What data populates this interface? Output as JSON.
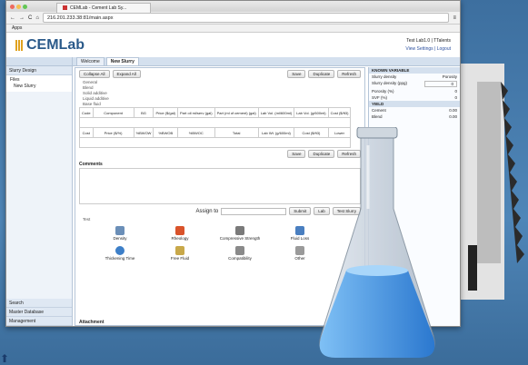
{
  "browser": {
    "tab_title": "CEMLab - Cement Lab Sy...",
    "url": "216.201.233.38:81/main.aspx",
    "bookmark": "Apps"
  },
  "app": {
    "logo_text": "CEMLab",
    "user_name": "Test Lab1.0 | TTalents",
    "user_links": "View Settings | Logout"
  },
  "sidebar": {
    "panel_title": "Slurry Design",
    "tree": [
      "Files",
      "New Slurry"
    ],
    "bottom_panels": [
      "Search",
      "Master Database",
      "Management"
    ]
  },
  "tabs": [
    "Welcome",
    "New Slurry"
  ],
  "toolbar": {
    "collapse_all": "Collapse All",
    "expand_all": "Expand All",
    "save": "Save",
    "duplicate": "Duplicate",
    "refresh": "Refresh"
  },
  "sections": [
    "General",
    "Blend",
    "Solid additive",
    "Liquid additive",
    "Base fluid"
  ],
  "table1": {
    "headers": [
      "Code",
      "Component",
      "BG",
      "Price ($/gal)",
      "Part oil ml/serv (gal)",
      "Part (ml of cement) (gal)",
      "Lab Vol. (ml/600ml)",
      "Lab Vol. (g/600ml)",
      "Cost ($/ft3)"
    ]
  },
  "table2": {
    "headers": [
      "Cost",
      "Price ($/%)",
      "%BWOW",
      "%BWOB",
      "%BWOC",
      "Total",
      "Lab Wt. (g/600ml)",
      "Cost ($/ft3)",
      "Lower"
    ]
  },
  "bottom_buttons": {
    "save": "Save",
    "duplicate": "Duplicate",
    "refresh": "Refresh"
  },
  "comments_label": "Comments",
  "assign": {
    "label": "Assign to",
    "submit": "Submit",
    "lab": "Lab",
    "test_slurry": "Test Slurry"
  },
  "test_section": "Test",
  "tests": [
    "Density",
    "Rheology",
    "Compressive Strength",
    "Fluid Loss",
    "Thickening Time",
    "Free Fluid",
    "Compatibility",
    "Other"
  ],
  "attachment_label": "Attachment",
  "right_panel": {
    "title": "KNOWN VARIABLE",
    "radio1": "Slurry density",
    "radio2": "Porosity",
    "rows": [
      {
        "label": "Slurry density (ppg)",
        "value": "0"
      },
      {
        "label": "Porosity (%)",
        "value": "0"
      },
      {
        "label": "SVF (%)",
        "value": "0"
      }
    ],
    "yield_label": "YIELD",
    "yield_rows": [
      {
        "label": "Cement",
        "value": "0.00"
      },
      {
        "label": "Blend",
        "value": "0.00"
      }
    ]
  },
  "colors": {
    "logo": "#2b5a8a",
    "background": "#4f86b8",
    "flask_liquid": "#3f8fe0"
  }
}
